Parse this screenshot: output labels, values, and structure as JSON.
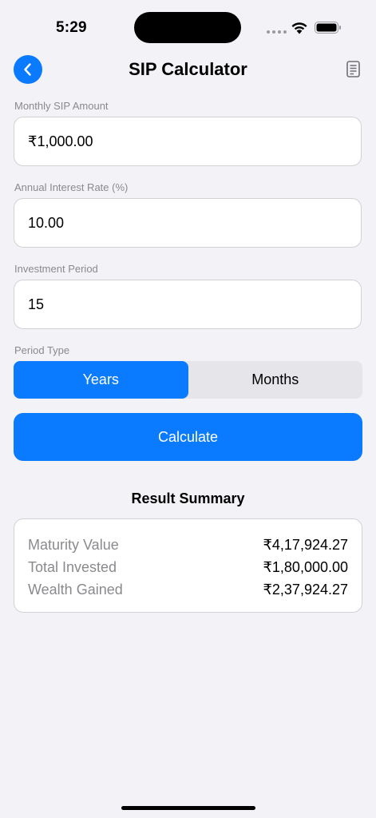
{
  "status_bar": {
    "time": "5:29"
  },
  "nav": {
    "title": "SIP Calculator",
    "back_icon": "chevron-left-icon",
    "doc_icon": "document-icon"
  },
  "form": {
    "monthly_amount": {
      "label": "Monthly SIP Amount",
      "value": "₹1,000.00"
    },
    "interest_rate": {
      "label": "Annual Interest Rate (%)",
      "value": "10.00"
    },
    "period": {
      "label": "Investment Period",
      "value": "15"
    },
    "period_type": {
      "label": "Period Type",
      "options": [
        "Years",
        "Months"
      ],
      "selected": "Years"
    },
    "calculate_label": "Calculate"
  },
  "results": {
    "title": "Result Summary",
    "rows": [
      {
        "label": "Maturity Value",
        "value": "₹4,17,924.27"
      },
      {
        "label": "Total Invested",
        "value": "₹1,80,000.00"
      },
      {
        "label": "Wealth Gained",
        "value": "₹2,37,924.27"
      }
    ]
  },
  "colors": {
    "accent": "#0A7AFF",
    "background": "#F2F2F7",
    "label": "#8A8A8E"
  }
}
